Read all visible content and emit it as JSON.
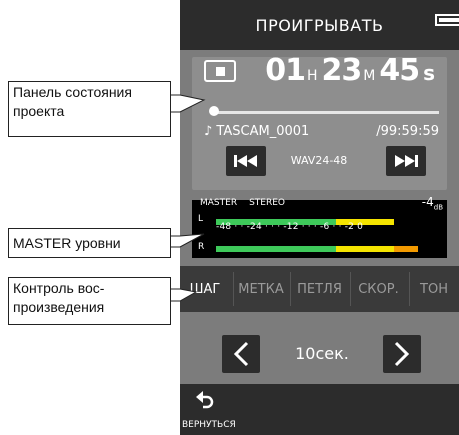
{
  "header": {
    "title": "ПРОИГРЫВАТЬ"
  },
  "project": {
    "time_hours": "01",
    "time_minutes": "23",
    "time_seconds": "45",
    "unit_h": "H",
    "unit_m": "M",
    "unit_s": "s",
    "filename": "♪ TASCAM_0001",
    "remaining": "/99:59:59",
    "format": "WAV24-48",
    "position_fraction": 0.0
  },
  "meter": {
    "label_master": "MASTER",
    "label_stereo": "STEREO",
    "db_value": "-4",
    "db_unit": "dB",
    "channel_l": "L",
    "channel_r": "R",
    "scale_text": "-48 · · -24 · · · -12 · · · -6 · · -2 0"
  },
  "tabs": [
    {
      "label": "ШАГ",
      "active": true
    },
    {
      "label": "МЕТКА",
      "active": false
    },
    {
      "label": "ПЕТЛЯ",
      "active": false
    },
    {
      "label": "СКОР.",
      "active": false
    },
    {
      "label": "ТОН",
      "active": false
    }
  ],
  "control": {
    "step_value": "10сек."
  },
  "footer": {
    "back_label": "ВЕРНУТЬСЯ"
  },
  "callouts": {
    "project_panel_line1": "Панель состояния",
    "project_panel_line2": "проекта",
    "master_levels": "MASTER уровни",
    "playback_line1": "Контроль вос-",
    "playback_line2": "произведения"
  },
  "colors": {
    "level_green": "#3ec95a",
    "level_yellow": "#f5e400",
    "level_orange": "#f29a00",
    "panel_dark": "#2c2c2c",
    "panel_gray": "#7c7c7c"
  }
}
